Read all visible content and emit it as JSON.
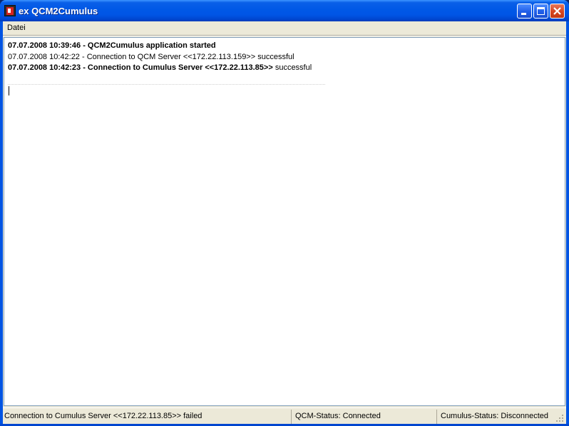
{
  "window": {
    "title": "ex QCM2Cumulus"
  },
  "menu": {
    "items": [
      "Datei"
    ]
  },
  "log": {
    "lines": [
      {
        "bold_part": "07.07.2008 10:39:46 - QCM2Cumulus application started",
        "normal_part": ""
      },
      {
        "bold_part": "",
        "normal_part": "07.07.2008 10:42:22 - Connection to QCM Server <<172.22.113.159>> successful"
      },
      {
        "bold_part": "07.07.2008 10:42:23 - Connection to Cumulus Server <<172.22.113.85>>",
        "normal_part": " successful"
      }
    ]
  },
  "status": {
    "message": "Connection to Cumulus Server <<172.22.113.85>> failed",
    "qcm": "QCM-Status: Connected",
    "cumulus": "Cumulus-Status: Disconnected"
  },
  "colors": {
    "titlebar": "#0055e5",
    "chrome": "#ece9d8",
    "close_button": "#d6441f"
  }
}
